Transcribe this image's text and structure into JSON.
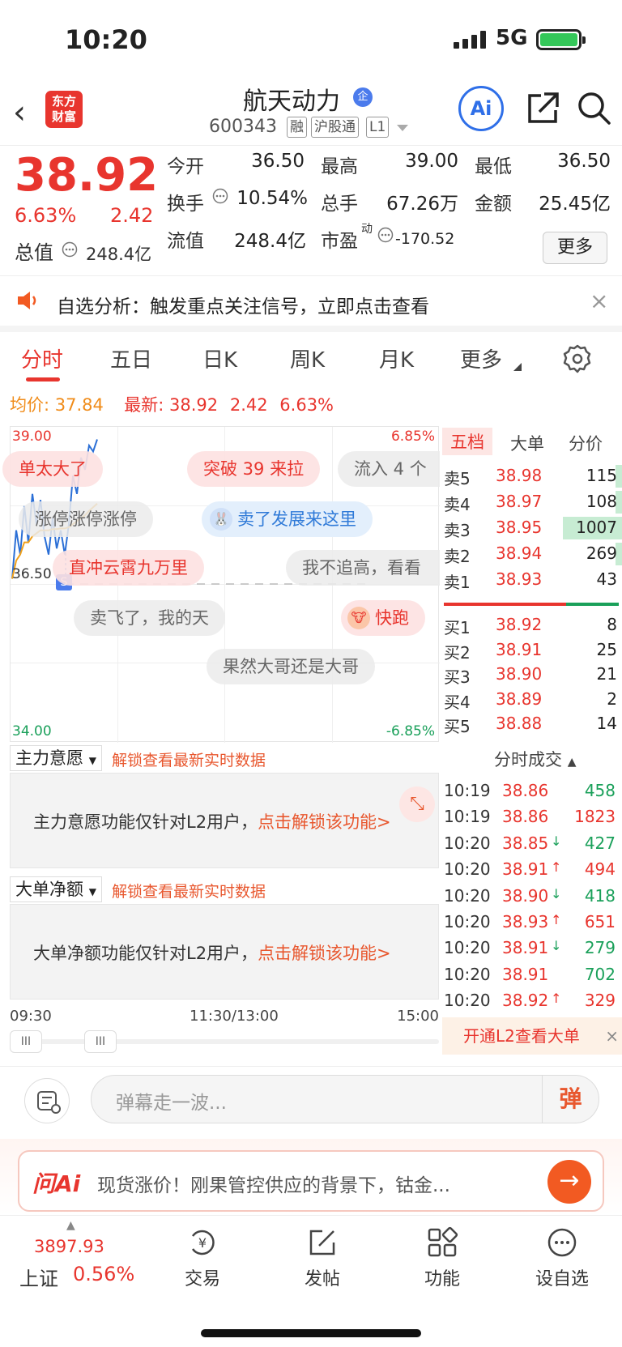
{
  "status": {
    "time": "10:20",
    "network": "5G"
  },
  "header": {
    "logo": [
      "东方",
      "财富"
    ],
    "name": "航天动力",
    "name_badge": "企",
    "code": "600343",
    "tags": [
      "融",
      "沪股通",
      "L1"
    ],
    "ai_label": "Ai"
  },
  "quote": {
    "price": "38.92",
    "pct": "6.63%",
    "change": "2.42",
    "total_value_label": "总值",
    "total_value": "248.4亿",
    "fields": [
      {
        "label": "今开",
        "value": "36.50",
        "color": "#222"
      },
      {
        "label": "最高",
        "value": "39.00",
        "color": "#e8352e"
      },
      {
        "label": "最低",
        "value": "36.50",
        "color": "#222"
      },
      {
        "label": "换手",
        "value": "10.54%",
        "color": "#222"
      },
      {
        "label": "总手",
        "value": "67.26万",
        "color": "#222"
      },
      {
        "label": "金额",
        "value": "25.45亿",
        "color": "#222"
      },
      {
        "label": "流值",
        "value": "248.4亿",
        "color": "#222"
      },
      {
        "label": "市盈",
        "label_sup": "动",
        "value": "-170.52",
        "color": "#222"
      }
    ],
    "more_label": "更多"
  },
  "notice": {
    "text": "自选分析：触发重点关注信号，立即点击查看",
    "close": "×"
  },
  "tabs": [
    "分时",
    "五日",
    "日K",
    "周K",
    "月K",
    "更多"
  ],
  "avgbar": {
    "avg_label": "均价:",
    "avg_value": "37.84",
    "latest_label": "最新:",
    "latest_value": "38.92",
    "change": "2.42",
    "pct": "6.63%"
  },
  "chart": {
    "y_top": "39.00",
    "y_mid": "36.50",
    "y_bottom": "34.00",
    "pct_top": "6.85%",
    "pct_bottom": "-6.85%",
    "marker": "S",
    "danmaku": [
      {
        "text": "单太大了",
        "style": "pink"
      },
      {
        "text": "突破 39 来拉",
        "style": "pink"
      },
      {
        "text": "流入 4 个",
        "style": "gray"
      },
      {
        "text": "涨停涨停涨停",
        "style": "gray"
      },
      {
        "text": "卖了发展来这里",
        "style": "blue"
      },
      {
        "text": "直冲云霄九万里",
        "style": "pink"
      },
      {
        "text": "我不追高，看看",
        "style": "gray"
      },
      {
        "text": "卖飞了，我的天",
        "style": "gray"
      },
      {
        "text": "快跑",
        "style": "pink"
      },
      {
        "text": "果然大哥还是大哥",
        "style": "gray"
      }
    ]
  },
  "chart_data": {
    "type": "line",
    "title": "",
    "xlabel": "",
    "ylabel": "",
    "ylim": [
      34.0,
      39.0
    ],
    "x_ticks": [
      "09:30",
      "11:30/13:00",
      "15:00"
    ],
    "x": [
      "09:30",
      "09:31",
      "09:32",
      "09:33",
      "09:34",
      "09:35",
      "09:36",
      "09:37",
      "09:38",
      "09:39",
      "09:40",
      "09:41",
      "09:42",
      "09:43",
      "09:44",
      "09:45",
      "09:46",
      "09:47",
      "09:48",
      "09:49",
      "09:50",
      "09:51"
    ],
    "series": [
      {
        "values": [
          36.6,
          37.4,
          37.0,
          37.8,
          37.2,
          38.0,
          37.5,
          37.9,
          37.3,
          37.0,
          37.6,
          37.1,
          37.4,
          37.0,
          37.5,
          38.3,
          38.0,
          38.6,
          38.4,
          38.8,
          38.7,
          38.9
        ],
        "color": "#2b6fd6"
      },
      {
        "values": [
          36.6,
          36.9,
          37.0,
          37.2,
          37.2,
          37.3,
          37.35,
          37.4,
          37.4,
          37.4,
          37.42,
          37.42,
          37.43,
          37.43,
          37.45,
          37.5,
          37.55,
          37.6,
          37.65,
          37.72,
          37.78,
          37.84
        ],
        "color": "#f0a01a"
      }
    ]
  },
  "book": {
    "tabs": [
      "五档",
      "大单",
      "分价"
    ],
    "asks": [
      {
        "label": "卖5",
        "price": "38.98",
        "vol": "115",
        "bar": 0.06
      },
      {
        "label": "卖4",
        "price": "38.97",
        "vol": "108",
        "bar": 0.06
      },
      {
        "label": "卖3",
        "price": "38.95",
        "vol": "1007",
        "bar": 0.52
      },
      {
        "label": "卖2",
        "price": "38.94",
        "vol": "269",
        "bar": 0.06
      },
      {
        "label": "卖1",
        "price": "38.93",
        "vol": "43",
        "bar": 0.0
      }
    ],
    "bids": [
      {
        "label": "买1",
        "price": "38.92",
        "vol": "8"
      },
      {
        "label": "买2",
        "price": "38.91",
        "vol": "25"
      },
      {
        "label": "买3",
        "price": "38.90",
        "vol": "21"
      },
      {
        "label": "买4",
        "price": "38.89",
        "vol": "2"
      },
      {
        "label": "买5",
        "price": "38.88",
        "vol": "14"
      }
    ]
  },
  "trades": {
    "title": "分时成交",
    "rows": [
      {
        "t": "10:19",
        "p": "38.86",
        "a": "",
        "v": "458",
        "vc": "#1aa05a"
      },
      {
        "t": "10:19",
        "p": "38.86",
        "a": "",
        "v": "1823",
        "vc": "#e8352e"
      },
      {
        "t": "10:20",
        "p": "38.85",
        "a": "↓",
        "v": "427",
        "vc": "#1aa05a"
      },
      {
        "t": "10:20",
        "p": "38.91",
        "a": "↑",
        "v": "494",
        "vc": "#e8352e"
      },
      {
        "t": "10:20",
        "p": "38.90",
        "a": "↓",
        "v": "418",
        "vc": "#1aa05a"
      },
      {
        "t": "10:20",
        "p": "38.93",
        "a": "↑",
        "v": "651",
        "vc": "#e8352e"
      },
      {
        "t": "10:20",
        "p": "38.91",
        "a": "↓",
        "v": "279",
        "vc": "#1aa05a"
      },
      {
        "t": "10:20",
        "p": "38.91",
        "a": "",
        "v": "702",
        "vc": "#1aa05a"
      },
      {
        "t": "10:20",
        "p": "38.92",
        "a": "↑",
        "v": "329",
        "vc": "#e8352e"
      }
    ],
    "l2_banner": "开通L2查看大单",
    "l2_close": "×"
  },
  "panels": [
    {
      "dropdown": "主力意愿",
      "unlock": "解锁查看最新实时数据",
      "msg": "主力意愿功能仅针对L2用户，",
      "link": "点击解锁该功能>"
    },
    {
      "dropdown": "大单净额",
      "unlock": "解锁查看最新实时数据",
      "msg": "大单净额功能仅针对L2用户，",
      "link": "点击解锁该功能>"
    }
  ],
  "scroller": {
    "handle": "III"
  },
  "danmu": {
    "placeholder": "弹幕走一波...",
    "button": "弹"
  },
  "ask_ai": {
    "logo": "问Ai",
    "text": "现货涨价！刚果管控供应的背景下，钴金..."
  },
  "index": {
    "value": "3897.93",
    "name": "上证",
    "pct": "0.56%"
  },
  "nav": [
    {
      "label": "交易",
      "icon": "trade-icon"
    },
    {
      "label": "发帖",
      "icon": "post-icon"
    },
    {
      "label": "功能",
      "icon": "function-icon"
    },
    {
      "label": "设自选",
      "icon": "add-watchlist-icon"
    }
  ],
  "colors": {
    "red": "#e8352e",
    "green": "#1aa05a",
    "orange": "#f08c1a",
    "blue": "#2b6fd6"
  }
}
